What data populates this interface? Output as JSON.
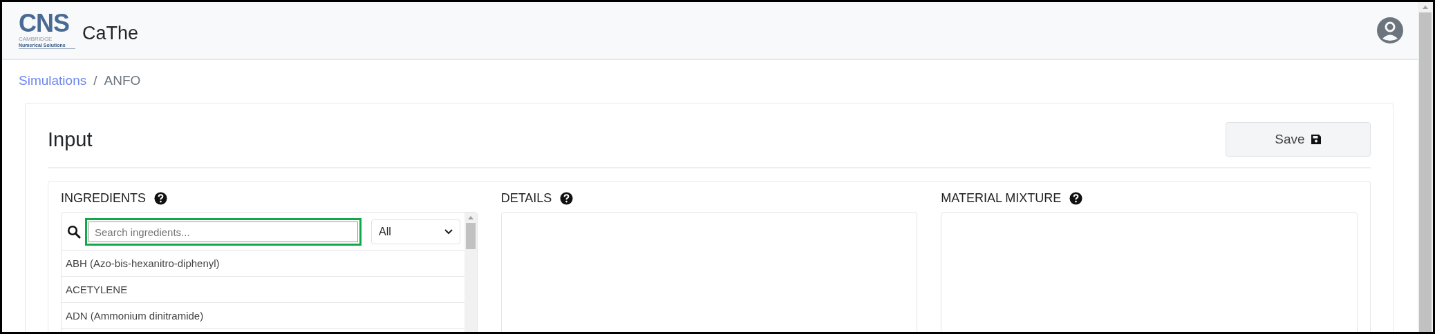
{
  "header": {
    "logo": {
      "wordmark": "CNS",
      "tagline_top": "CAMBRIDGE",
      "tagline": "Numerical Solutions"
    },
    "app_name": "CaThe"
  },
  "breadcrumb": [
    {
      "label": "Simulations",
      "kind": "link"
    },
    {
      "label": "ANFO",
      "kind": "current"
    }
  ],
  "breadcrumb_separator": "/",
  "page": {
    "title": "Input",
    "save_button": "Save"
  },
  "ingredients": {
    "title": "INGREDIENTS",
    "search": {
      "placeholder": "Search ingredients...",
      "highlighted": true
    },
    "filter": "All",
    "items": [
      {
        "label": "ABH (Azo-bis-hexanitro-diphenyl)"
      },
      {
        "label": "ACETYLENE"
      },
      {
        "label": "ADN (Ammonium dinitramide)"
      }
    ]
  },
  "details": {
    "title": "DETAILS"
  },
  "material_mixture": {
    "title": "MATERIAL MIXTURE"
  }
}
